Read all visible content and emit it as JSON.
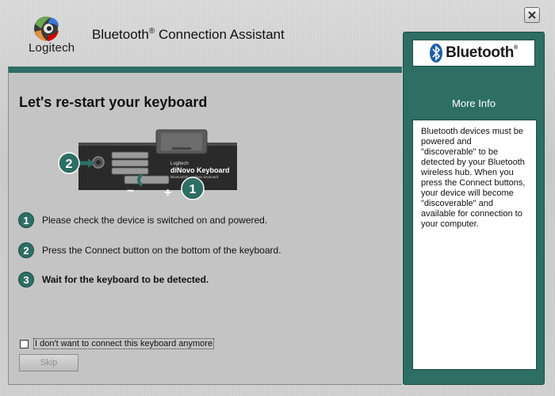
{
  "app": {
    "logo_text": "Logitech",
    "title": "Bluetooth",
    "title_mark": "®",
    "title_rest": " Connection Assistant",
    "close_icon": "close-x"
  },
  "main": {
    "heading": "Let's re-start your keyboard",
    "image": {
      "brand_small": "Logitech",
      "product_name": "diNovo Keyboard",
      "product_sub": "Bluetooth® cordless keyboard",
      "callout_1": "1",
      "callout_2": "2",
      "minus": "−",
      "plus": "+"
    },
    "steps": [
      {
        "num": "1",
        "text": "Please check the device is switched on and powered."
      },
      {
        "num": "2",
        "text": "Press the Connect button on the bottom of the keyboard."
      },
      {
        "num": "3",
        "text": "Wait for the keyboard to be detected."
      }
    ],
    "opt_out_label": "I don't want to connect this keyboard anymore",
    "opt_out_checked": false,
    "skip_label": "Skip"
  },
  "sidebar": {
    "brand": "Bluetooth",
    "brand_mark": "®",
    "section_title": "More Info",
    "info_text": "Bluetooth devices must be powered and \"discoverable\" to be detected by your Bluetooth wireless hub. When you press the Connect buttons, your device will become \"discoverable\" and available for connection to your computer."
  },
  "colors": {
    "accent": "#2d6e65",
    "panel": "#c4c4c4",
    "chrome": "#cfcfcf"
  }
}
